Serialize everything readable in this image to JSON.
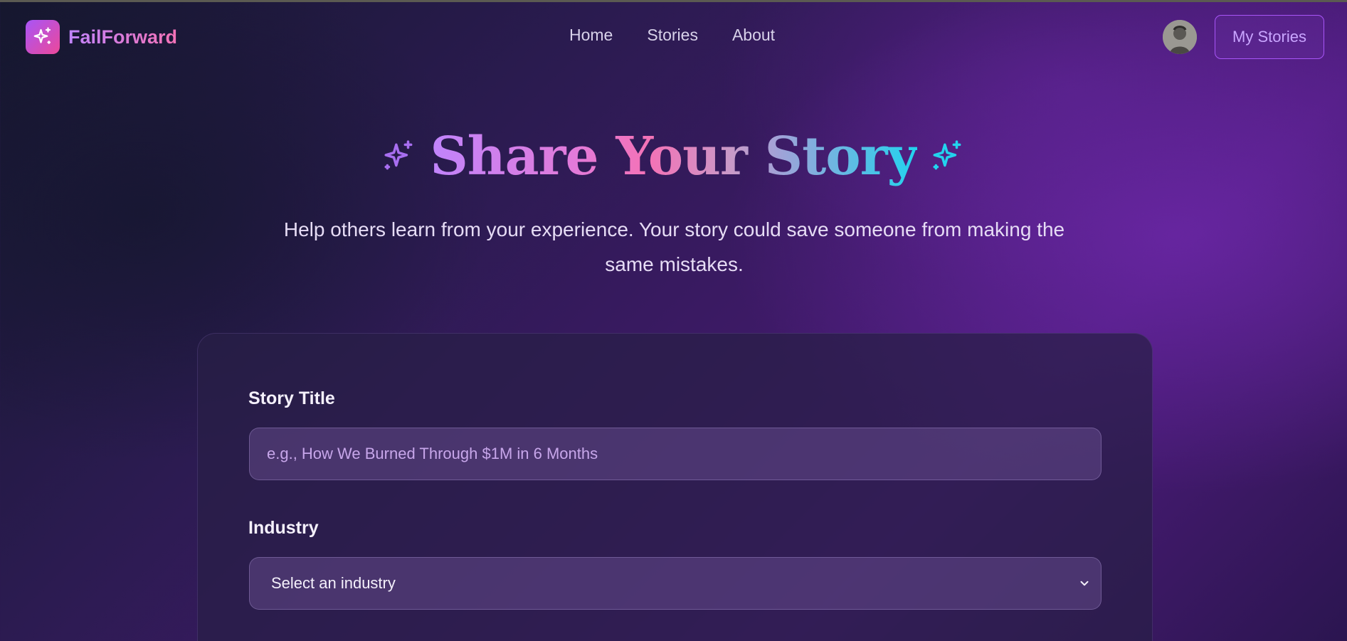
{
  "header": {
    "brand_name": "FailForward",
    "brand_icon": "sparkles-icon",
    "nav": [
      {
        "label": "Home"
      },
      {
        "label": "Stories"
      },
      {
        "label": "About"
      }
    ],
    "my_stories_label": "My Stories"
  },
  "hero": {
    "title": "Share Your Story",
    "subtitle": "Help others learn from your experience. Your story could save someone from making the same mistakes."
  },
  "form": {
    "title_label": "Story Title",
    "title_placeholder": "e.g., How We Burned Through $1M in 6 Months",
    "title_value": "",
    "industry_label": "Industry",
    "industry_selected": "Select an industry"
  },
  "colors": {
    "accent_purple": "#a855f7",
    "accent_pink": "#ec4899",
    "accent_cyan": "#22d3ee"
  }
}
